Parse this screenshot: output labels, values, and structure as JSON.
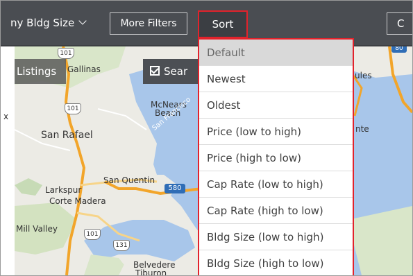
{
  "topbar": {
    "bldg_size_label": "ny Bldg Size",
    "more_filters_label": "More Filters",
    "sort_label": "Sort",
    "right_button_label": "C"
  },
  "map": {
    "listings_label": "Listings",
    "search_label": "Sear",
    "places": {
      "gallinas": "Gallinas",
      "mcnears": "McNears",
      "beach": "Beach",
      "san_rafael": "San Rafael",
      "san_francisco_bay": "San Francisco",
      "san_quentin": "San Quentin",
      "larkspur": "Larkspur",
      "corte_madera": "Corte Madera",
      "mill_valley": "Mill Valley",
      "belvedere": "Belvedere",
      "tiburon": "Tiburon",
      "x": "x",
      "ules": "ules",
      "nte": "nte"
    },
    "highways": {
      "h101a": "101",
      "h101b": "101",
      "h101c": "101",
      "h131": "131",
      "h580": "580",
      "h80": "80"
    }
  },
  "sort_menu": {
    "options": [
      "Default",
      "Newest",
      "Oldest",
      "Price (low to high)",
      "Price (high to low)",
      "Cap Rate (low to high)",
      "Cap Rate (high to low)",
      "Bldg Size (low to high)",
      "Bldg Size (high to low)"
    ],
    "selected": "Default"
  },
  "colors": {
    "topbar_bg": "#4a4d52",
    "highlight_red": "#e2222b",
    "water": "#a8c6ea",
    "land": "#ecebe5",
    "highway": "#f2a52a"
  }
}
